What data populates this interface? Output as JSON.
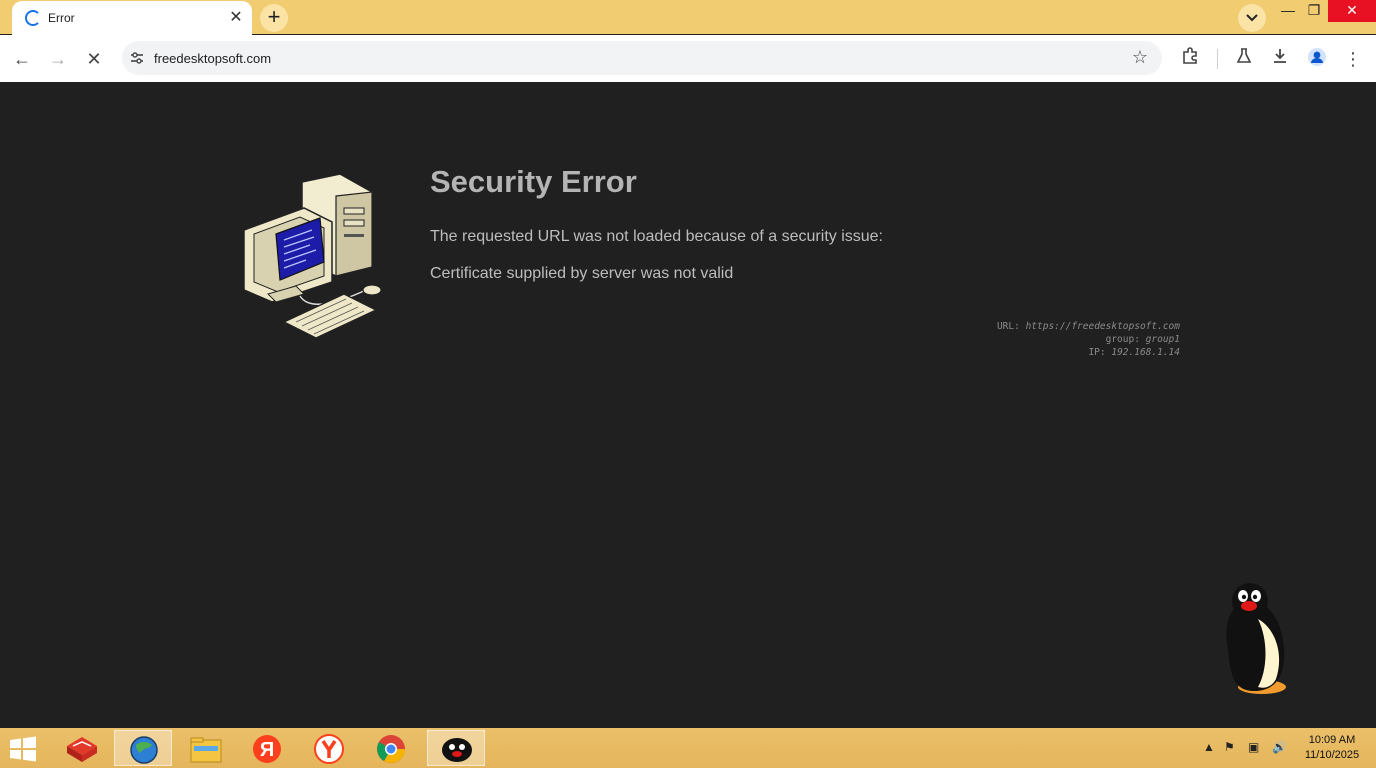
{
  "browser": {
    "tab_title": "Error",
    "address": "freedesktopsoft.com"
  },
  "error_page": {
    "title": "Security Error",
    "description": "The requested URL was not loaded because of a security issue:",
    "reason": "Certificate supplied by server was not valid",
    "details": {
      "url_label": "URL:",
      "url_value": "https://freedesktopsoft.com",
      "group_label": "group:",
      "group_value": "group1",
      "ip_label": "IP:",
      "ip_value": "192.168.1.14"
    }
  },
  "taskbar": {
    "apps": [
      "start-menu-icon",
      "app-red-package-icon",
      "browser-globe-icon",
      "file-explorer-icon",
      "yandex-ya-icon",
      "yandex-browser-icon",
      "chrome-icon",
      "pingu-icon"
    ],
    "clock_time": "10:09 AM",
    "clock_date": "11/10/2025"
  },
  "colors": {
    "page_background": "#212021",
    "titlebar": "#f1cc70",
    "taskbar": "#e8bb62"
  }
}
